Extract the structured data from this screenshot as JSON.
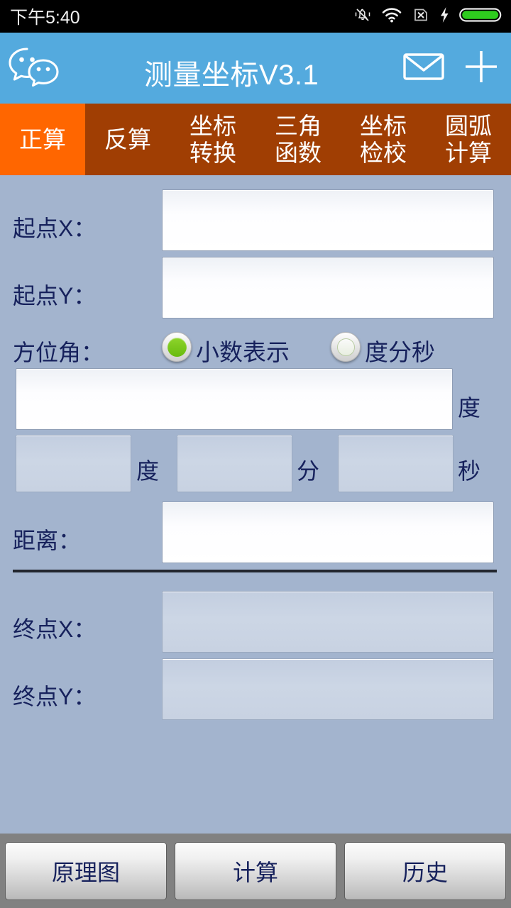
{
  "statusbar": {
    "time": "下午5:40",
    "icons": [
      {
        "name": "silent-mode-icon"
      },
      {
        "name": "wifi-icon"
      },
      {
        "name": "no-sim-icon"
      },
      {
        "name": "charging-bolt-icon"
      },
      {
        "name": "battery-icon"
      }
    ]
  },
  "titlebar": {
    "logo": "wechat-logo",
    "title": "测量坐标V3.1",
    "mail_icon": "mail-icon",
    "add_icon": "plus-icon"
  },
  "tabs": [
    {
      "line1": "正算",
      "line2": "",
      "active": true
    },
    {
      "line1": "反算",
      "line2": "",
      "active": false
    },
    {
      "line1": "坐标",
      "line2": "转换",
      "active": false
    },
    {
      "line1": "三角",
      "line2": "函数",
      "active": false
    },
    {
      "line1": "坐标",
      "line2": "检校",
      "active": false
    },
    {
      "line1": "圆弧",
      "line2": "计算",
      "active": false
    }
  ],
  "form": {
    "start_x_label": "起点X：",
    "start_x_value": "",
    "start_y_label": "起点Y：",
    "start_y_value": "",
    "azimuth_label": "方位角：",
    "radio_decimal": "小数表示",
    "radio_dms": "度分秒",
    "decimal_value": "",
    "decimal_unit": "度",
    "deg_value": "",
    "deg_unit": "度",
    "min_value": "",
    "min_unit": "分",
    "sec_value": "",
    "sec_unit": "秒",
    "distance_label": "距离：",
    "distance_value": "",
    "end_x_label": "终点X：",
    "end_x_value": "",
    "end_y_label": "终点Y：",
    "end_y_value": ""
  },
  "buttons": {
    "diagram": "原理图",
    "calculate": "计算",
    "history": "历史"
  },
  "colors": {
    "titlebar": "#54aade",
    "tab_active": "#ff6600",
    "tab_inactive": "#a03e03",
    "body_bg": "#a3b4ce",
    "label_text": "#16215c",
    "radio_on": "#68bb0e",
    "bottombar": "#818181"
  }
}
